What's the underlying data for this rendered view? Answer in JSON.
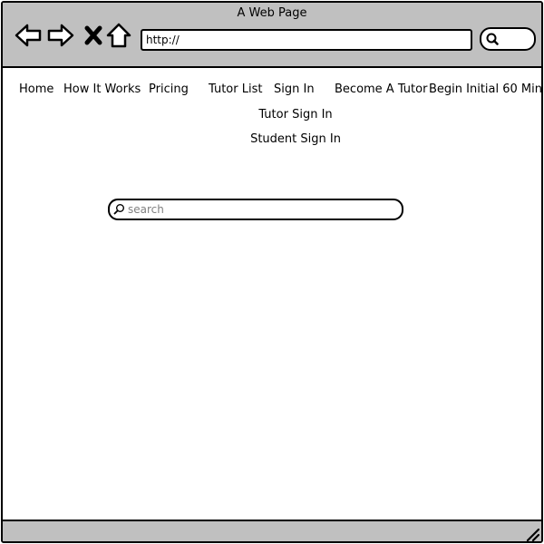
{
  "window": {
    "title": "A Web Page"
  },
  "toolbar": {
    "back_icon": "back-arrow-icon",
    "forward_icon": "forward-arrow-icon",
    "stop_icon": "close-x-icon",
    "home_icon": "home-icon",
    "url_value": "http://",
    "browser_search_icon": "search-icon"
  },
  "nav": {
    "items": [
      {
        "label": "Home"
      },
      {
        "label": "How It Works"
      },
      {
        "label": "Pricing"
      },
      {
        "label": "Tutor List"
      },
      {
        "label": "Sign In"
      },
      {
        "label": "Become A Tutor"
      },
      {
        "label": "Begin Initial 60 Min"
      }
    ],
    "sign_in_options": [
      {
        "label": "Tutor Sign In"
      },
      {
        "label": "Student Sign In"
      }
    ]
  },
  "search": {
    "placeholder": "search",
    "icon": "search-icon"
  },
  "statusbar": {
    "grip_icon": "resize-grip-icon"
  },
  "colors": {
    "chrome": "#c0c0c0",
    "border": "#000000",
    "background": "#ffffff",
    "placeholder": "#808080"
  }
}
